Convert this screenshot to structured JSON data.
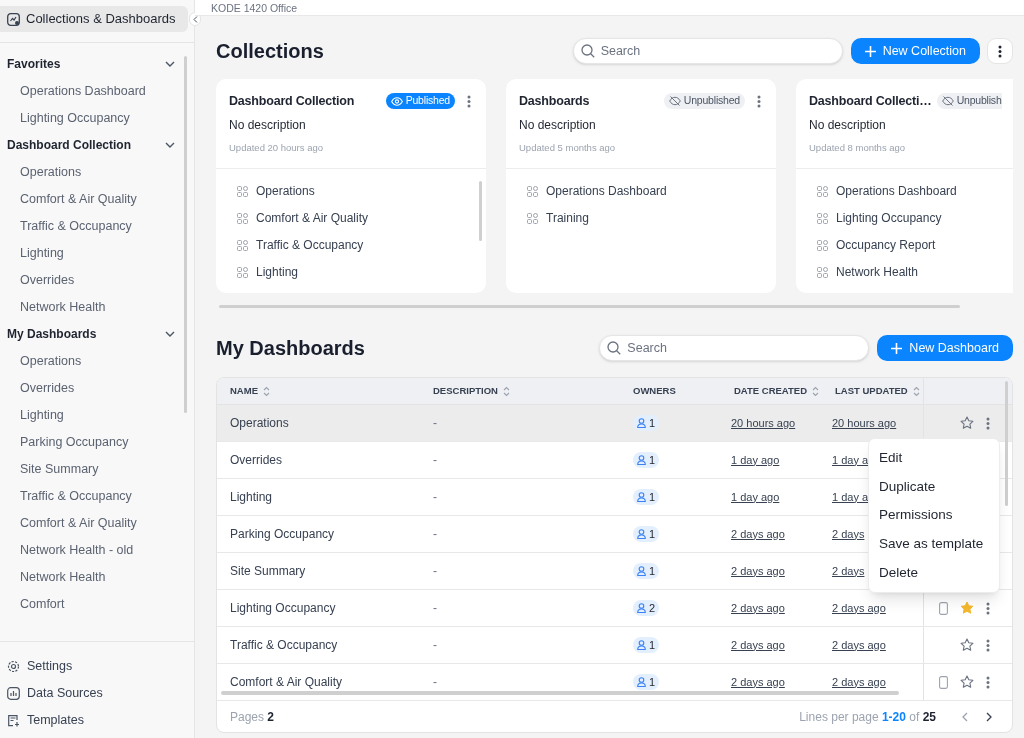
{
  "sidebar": {
    "header": {
      "label": "Collections & Dashboards",
      "selected": true
    },
    "sections": [
      {
        "title": "Favorites",
        "expanded": true,
        "items": [
          "Operations Dashboard",
          "Lighting Occupancy"
        ]
      },
      {
        "title": "Dashboard Collection",
        "expanded": true,
        "items": [
          "Operations",
          "Comfort & Air Quality",
          "Traffic & Occupancy",
          "Lighting",
          "Overrides",
          "Network Health"
        ]
      },
      {
        "title": "My Dashboards",
        "expanded": true,
        "items": [
          "Operations",
          "Overrides",
          "Lighting",
          "Parking Occupancy",
          "Site Summary",
          "Traffic & Occupancy",
          "Comfort & Air Quality",
          "Network Health - old",
          "Network Health",
          "Comfort"
        ]
      }
    ],
    "footer": [
      {
        "kind": "settings",
        "label": "Settings"
      },
      {
        "kind": "data",
        "label": "Data Sources"
      },
      {
        "kind": "templates",
        "label": "Templates"
      }
    ]
  },
  "breadcrumb": "KODE 1420 Office",
  "collections": {
    "title": "Collections",
    "search": {
      "placeholder": "Search"
    },
    "new_button": "New Collection",
    "cards": [
      {
        "title": "Dashboard Collection",
        "published": true,
        "status": "Published",
        "description": "No description",
        "updated": "Updated 20 hours ago",
        "items": [
          "Operations",
          "Comfort & Air Quality",
          "Traffic & Occupancy",
          "Lighting"
        ]
      },
      {
        "title": "Dashboards",
        "published": false,
        "status": "Unpublished",
        "description": "No description",
        "updated": "Updated 5 months ago",
        "items": [
          "Operations Dashboard",
          "Training"
        ]
      },
      {
        "title": "Dashboard Collecti…",
        "published": false,
        "status": "Unpublish",
        "description": "No description",
        "updated": "Updated 8 months ago",
        "items": [
          "Operations Dashboard",
          "Lighting Occupancy",
          "Occupancy Report",
          "Network Health"
        ]
      }
    ]
  },
  "dashboards": {
    "title": "My Dashboards",
    "search": {
      "placeholder": "Search"
    },
    "new_button": "New Dashboard",
    "columns": [
      {
        "label": "NAME",
        "sortable": true
      },
      {
        "label": "DESCRIPTION",
        "sortable": true
      },
      {
        "label": "OWNERS",
        "sortable": false
      },
      {
        "label": "DATE CREATED",
        "sortable": true
      },
      {
        "label": "LAST UPDATED",
        "sortable": true
      }
    ],
    "rows": [
      {
        "name": "Operations",
        "description": "-",
        "owners": "1",
        "created": "20 hours ago",
        "updated": "20 hours ago",
        "selected": true,
        "favorite": false,
        "mobile": false
      },
      {
        "name": "Overrides",
        "description": "-",
        "owners": "1",
        "created": "1 day ago",
        "updated": "1 day a",
        "selected": false
      },
      {
        "name": "Lighting",
        "description": "-",
        "owners": "1",
        "created": "1 day ago",
        "updated": "1 day a",
        "selected": false
      },
      {
        "name": "Parking Occupancy",
        "description": "-",
        "owners": "1",
        "created": "2 days ago",
        "updated": "2 days",
        "selected": false
      },
      {
        "name": "Site Summary",
        "description": "-",
        "owners": "1",
        "created": "2 days ago",
        "updated": "2 days",
        "selected": false
      },
      {
        "name": "Lighting Occupancy",
        "description": "-",
        "owners": "2",
        "created": "2 days ago",
        "updated": "2 days ago",
        "selected": false,
        "favorite": true,
        "mobile": true
      },
      {
        "name": "Traffic & Occupancy",
        "description": "-",
        "owners": "1",
        "created": "2 days ago",
        "updated": "2 days ago",
        "selected": false,
        "favorite": false,
        "mobile": false
      },
      {
        "name": "Comfort & Air Quality",
        "description": "-",
        "owners": "1",
        "created": "2 days ago",
        "updated": "2 days ago",
        "selected": false,
        "favorite": false,
        "mobile": true
      }
    ],
    "menu": [
      "Edit",
      "Duplicate",
      "Permissions",
      "Save as template",
      "Delete"
    ],
    "footer": {
      "pages_label": "Pages",
      "pages": "2",
      "lines_label": "Lines per page",
      "range": "1-20",
      "of": "of",
      "total": "25"
    }
  }
}
